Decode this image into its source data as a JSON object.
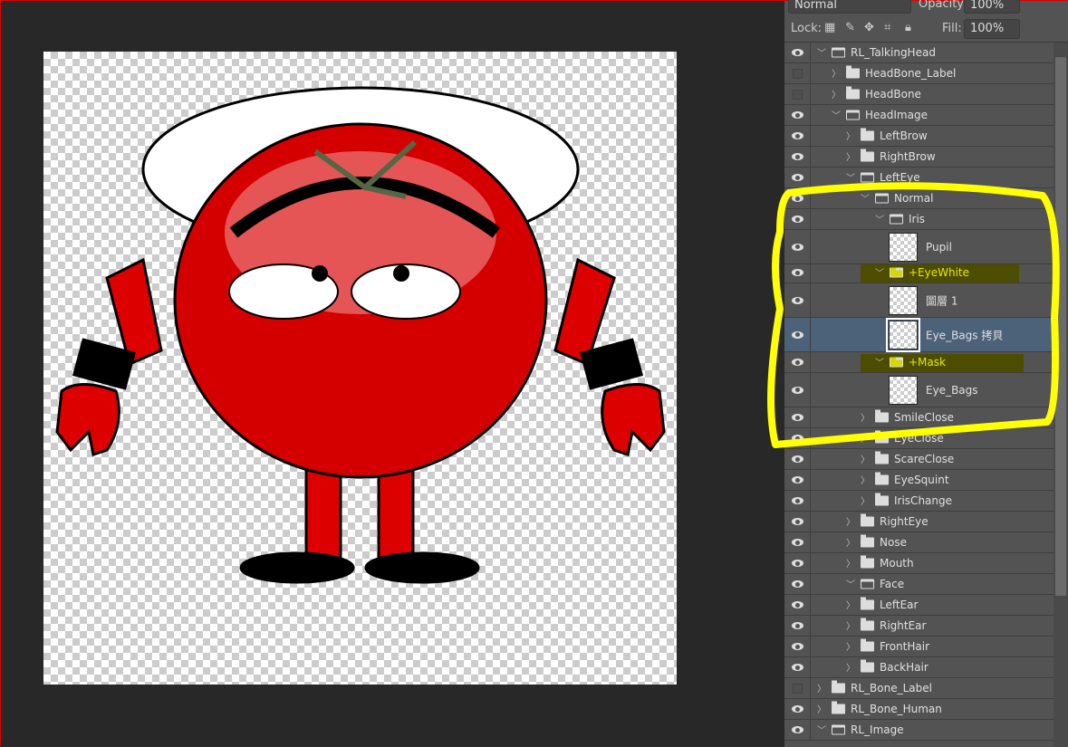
{
  "toolbar": {
    "blend_mode": "Normal",
    "opacity_label": "Opacity:",
    "opacity": "100%",
    "lock_label": "Lock:",
    "fill_label": "Fill:",
    "fill": "100%"
  },
  "colors": {
    "annotation": "#ffff00",
    "highlight": "#4d4d00",
    "selected_row": "#4c6279",
    "panel": "#535353"
  },
  "layers": [
    {
      "name": "RL_TalkingHead",
      "type": "group",
      "depth": 0,
      "expanded": true,
      "visible": true
    },
    {
      "name": "HeadBone_Label",
      "type": "group",
      "depth": 1,
      "expanded": false,
      "visible": false
    },
    {
      "name": "HeadBone",
      "type": "group",
      "depth": 1,
      "expanded": false,
      "visible": false
    },
    {
      "name": "HeadImage",
      "type": "group",
      "depth": 1,
      "expanded": true,
      "visible": true
    },
    {
      "name": "LeftBrow",
      "type": "group",
      "depth": 2,
      "expanded": false,
      "visible": true
    },
    {
      "name": "RightBrow",
      "type": "group",
      "depth": 2,
      "expanded": false,
      "visible": true
    },
    {
      "name": "LeftEye",
      "type": "group",
      "depth": 2,
      "expanded": true,
      "visible": true
    },
    {
      "name": "Normal",
      "type": "group",
      "depth": 3,
      "expanded": true,
      "visible": true
    },
    {
      "name": "Iris",
      "type": "group",
      "depth": 4,
      "expanded": true,
      "visible": true
    },
    {
      "name": "Pupil",
      "type": "layer",
      "depth": 5,
      "visible": true
    },
    {
      "name": "+EyeWhite",
      "type": "group",
      "depth": 4,
      "expanded": true,
      "visible": true,
      "highlight": true
    },
    {
      "name": "圖層 1",
      "type": "layer",
      "depth": 5,
      "visible": true
    },
    {
      "name": "Eye_Bags 拷貝",
      "type": "layer",
      "depth": 5,
      "visible": true,
      "selected": true
    },
    {
      "name": "+Mask",
      "type": "group",
      "depth": 4,
      "expanded": true,
      "visible": true,
      "highlight": true
    },
    {
      "name": "Eye_Bags",
      "type": "layer",
      "depth": 5,
      "visible": true
    },
    {
      "name": "SmileClose",
      "type": "group",
      "depth": 3,
      "expanded": false,
      "visible": true
    },
    {
      "name": "EyeClose",
      "type": "group",
      "depth": 3,
      "expanded": false,
      "visible": true
    },
    {
      "name": "ScareClose",
      "type": "group",
      "depth": 3,
      "expanded": false,
      "visible": true
    },
    {
      "name": "EyeSquint",
      "type": "group",
      "depth": 3,
      "expanded": false,
      "visible": true
    },
    {
      "name": "IrisChange",
      "type": "group",
      "depth": 3,
      "expanded": false,
      "visible": true
    },
    {
      "name": "RightEye",
      "type": "group",
      "depth": 2,
      "expanded": false,
      "visible": true
    },
    {
      "name": "Nose",
      "type": "group",
      "depth": 2,
      "expanded": false,
      "visible": true
    },
    {
      "name": "Mouth",
      "type": "group",
      "depth": 2,
      "expanded": false,
      "visible": true
    },
    {
      "name": "Face",
      "type": "group",
      "depth": 2,
      "expanded": true,
      "visible": true
    },
    {
      "name": "LeftEar",
      "type": "group",
      "depth": 2,
      "expanded": false,
      "visible": true
    },
    {
      "name": "RightEar",
      "type": "group",
      "depth": 2,
      "expanded": false,
      "visible": true
    },
    {
      "name": "FrontHair",
      "type": "group",
      "depth": 2,
      "expanded": false,
      "visible": true
    },
    {
      "name": "BackHair",
      "type": "group",
      "depth": 2,
      "expanded": false,
      "visible": true
    },
    {
      "name": "RL_Bone_Label",
      "type": "group",
      "depth": 0,
      "expanded": false,
      "visible": false
    },
    {
      "name": "RL_Bone_Human",
      "type": "group",
      "depth": 0,
      "expanded": false,
      "visible": true
    },
    {
      "name": "RL_Image",
      "type": "group",
      "depth": 0,
      "expanded": true,
      "visible": true
    }
  ]
}
